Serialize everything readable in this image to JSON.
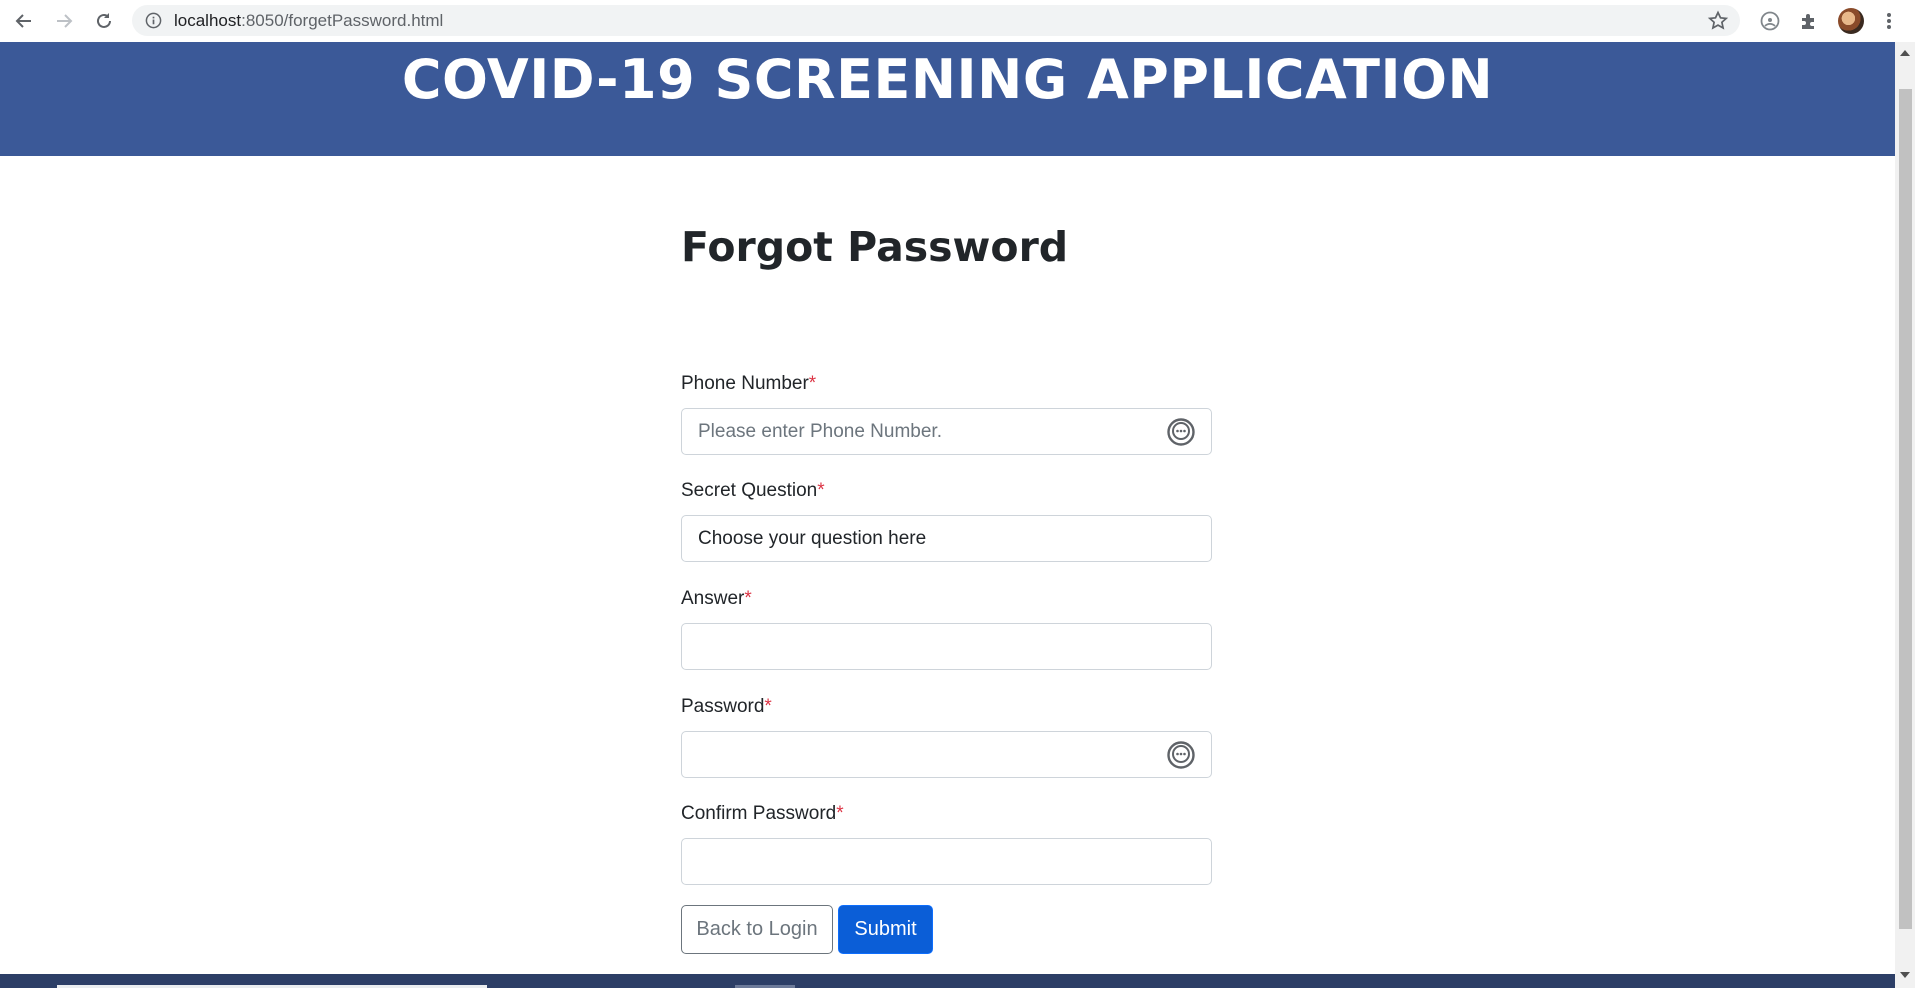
{
  "browser": {
    "url_host": "localhost",
    "url_rest": ":8050/forgetPassword.html",
    "icons": [
      "back-icon",
      "forward-icon",
      "reload-icon",
      "site-info-icon",
      "bookmark-star-icon",
      "extension-icon",
      "puzzle-icon",
      "avatar",
      "menu-icon"
    ]
  },
  "banner": {
    "title": "COVID-19 SCREENING APPLICATION",
    "color": "#3b5998"
  },
  "form": {
    "heading": "Forgot Password",
    "required_mark": "*",
    "phone": {
      "label": "Phone Number",
      "placeholder": "Please enter Phone Number.",
      "value": ""
    },
    "question": {
      "label": "Secret Question",
      "selected": "Choose your question here"
    },
    "answer": {
      "label": "Answer",
      "value": ""
    },
    "password": {
      "label": "Password",
      "value": ""
    },
    "confirm": {
      "label": "Confirm Password",
      "value": ""
    },
    "back_label": "Back to Login",
    "submit_label": "Submit",
    "submit_color": "#0b5ed7",
    "required_color": "#dc3545"
  }
}
